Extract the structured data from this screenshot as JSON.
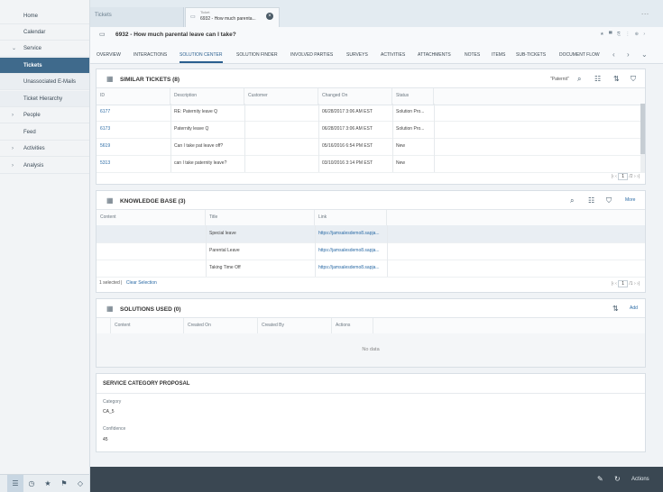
{
  "sidebar": {
    "items": [
      {
        "label": "Home",
        "chevron": ""
      },
      {
        "label": "Calendar",
        "chevron": ""
      },
      {
        "label": "Service",
        "chevron": "⌄"
      },
      {
        "label": "Tickets",
        "chevron": ""
      },
      {
        "label": "Unassociated E-Mails",
        "chevron": ""
      },
      {
        "label": "Ticket Hierarchy",
        "chevron": ""
      },
      {
        "label": "People",
        "chevron": "›"
      },
      {
        "label": "Feed",
        "chevron": ""
      },
      {
        "label": "Activities",
        "chevron": "›"
      },
      {
        "label": "Analysis",
        "chevron": "›"
      }
    ],
    "bottom_icons": [
      "list-icon",
      "clock-icon",
      "star-icon",
      "flag-icon",
      "tag-icon"
    ]
  },
  "top_tabs": {
    "tab1": "Tickets",
    "tab2_small": "Ticket",
    "tab2_title": "6932 - How much parenta...",
    "close": "×",
    "more": "..."
  },
  "header": {
    "title": "6932 - How much parental leave can I take?",
    "actions": "★ ▀ ⎘ ⋮ ⊕ ›",
    "tabs": [
      "OVERVIEW",
      "INTERACTIONS",
      "SOLUTION CENTER",
      "SOLUTION FINDER",
      "INVOLVED PARTIES",
      "SURVEYS",
      "ACTIVITIES",
      "ATTACHMENTS",
      "NOTES",
      "ITEMS",
      "SUB-TICKETS",
      "DOCUMENT FLOW"
    ],
    "active_tab": "SOLUTION CENTER"
  },
  "similar_tickets": {
    "title": "SIMILAR TICKETS (8)",
    "filter_text": "\"Paternit\"",
    "columns": [
      "ID",
      "Description",
      "Customer",
      "Changed On",
      "Status"
    ],
    "rows": [
      [
        "6177",
        "RE: Paternity leave Q",
        "",
        "06/28/2017 3:06 AM EST",
        "Solution Pro..."
      ],
      [
        "6173",
        "Paternity leave Q",
        "",
        "06/28/2017 3:06 AM EST",
        "Solution Pro..."
      ],
      [
        "5619",
        "Can I take pat leave off?",
        "",
        "05/16/2016 6:54 PM EST",
        "New"
      ],
      [
        "5313",
        "can I take paternity leave?",
        "",
        "03/10/2016 3:14 PM EST",
        "New"
      ]
    ],
    "pager": {
      "page": "1",
      "total": "/2"
    }
  },
  "knowledge_base": {
    "title": "KNOWLEDGE BASE (3)",
    "more": "More",
    "columns": [
      "Content",
      "Title",
      "Link"
    ],
    "rows": [
      [
        "",
        "Special leave",
        "https://jamsalesdemo8.sapja..."
      ],
      [
        "",
        "Parental Leave",
        "https://jamsalesdemo8.sapja..."
      ],
      [
        "",
        "Taking Time Off",
        "https://jamsalesdemo8.sapja..."
      ]
    ],
    "selected": "1 selected",
    "clear": "Clear Selection",
    "pager": {
      "page": "1",
      "total": "/1"
    }
  },
  "solutions_used": {
    "title": "SOLUTIONS USED (0)",
    "add": "Add",
    "columns": [
      "Content",
      "Created On",
      "Created By",
      "Actions"
    ],
    "no_data": "No data"
  },
  "service_category": {
    "title": "SERVICE CATEGORY PROPOSAL",
    "category_label": "Category",
    "category_value": "CA_5",
    "confidence_label": "Confidence",
    "confidence_value": "45"
  },
  "bottom_bar": {
    "actions": "Actions"
  }
}
